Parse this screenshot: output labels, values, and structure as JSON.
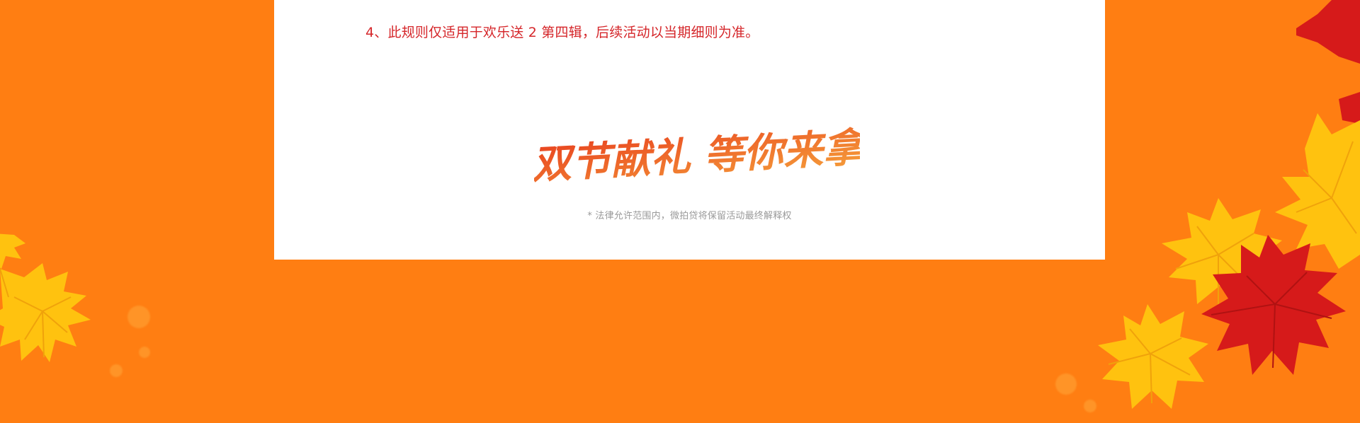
{
  "rules": {
    "item_4": "4、此规则仅适用于欢乐送 2 第四辑，后续活动以当期细则为准。"
  },
  "slogan": {
    "text": "双节献礼 等你来拿"
  },
  "footer": {
    "disclaimer": "* 法律允许范围内，微拍贷将保留活动最终解释权"
  },
  "colors": {
    "background_orange": "#ff7e12",
    "panel_white": "#ffffff",
    "rule_red": "#d5262a",
    "disclaimer_gray": "#9a9a9a",
    "slogan_gradient_start": "#e8401f",
    "slogan_gradient_end": "#f6a23b",
    "leaf_yellow": "#ffc20f",
    "leaf_red": "#d61a1a"
  },
  "icons": {
    "decor_left": "maple-leaf-cluster",
    "decor_right": "maple-leaf-cluster"
  }
}
